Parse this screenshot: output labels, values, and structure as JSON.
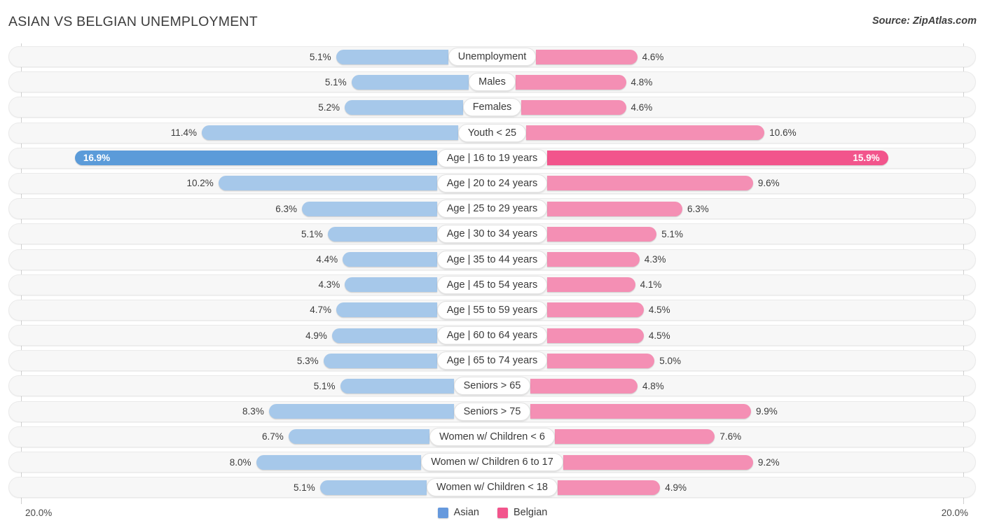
{
  "header": {
    "title": "ASIAN VS BELGIAN UNEMPLOYMENT",
    "source": "Source: ZipAtlas.com"
  },
  "footer": {
    "axis_left": "20.0%",
    "axis_right": "20.0%",
    "legend": [
      {
        "label": "Asian",
        "color": "#6699dd"
      },
      {
        "label": "Belgian",
        "color": "#f2558c"
      }
    ]
  },
  "colors": {
    "asian_light": "#a6c8ea",
    "asian_dark": "#5b9bd9",
    "belgian_light": "#f48fb4",
    "belgian_dark": "#f2558c",
    "track": "#f7f7f7",
    "axis": "#cfcfcf"
  },
  "chart_data": {
    "type": "bar",
    "subtype": "diverging-bidirectional",
    "title": "ASIAN VS BELGIAN UNEMPLOYMENT",
    "xlabel": "",
    "ylabel": "",
    "xlim": [
      0,
      20
    ],
    "axis_max_label": "20.0%",
    "grid": false,
    "legend_position": "bottom-center",
    "categories": [
      "Unemployment",
      "Males",
      "Females",
      "Youth < 25",
      "Age | 16 to 19 years",
      "Age | 20 to 24 years",
      "Age | 25 to 29 years",
      "Age | 30 to 34 years",
      "Age | 35 to 44 years",
      "Age | 45 to 54 years",
      "Age | 55 to 59 years",
      "Age | 60 to 64 years",
      "Age | 65 to 74 years",
      "Seniors > 65",
      "Seniors > 75",
      "Women w/ Children < 6",
      "Women w/ Children 6 to 17",
      "Women w/ Children < 18"
    ],
    "series": [
      {
        "name": "Asian",
        "values": [
          5.1,
          5.1,
          5.2,
          11.4,
          16.9,
          10.2,
          6.3,
          5.1,
          4.4,
          4.3,
          4.7,
          4.9,
          5.3,
          5.1,
          8.3,
          6.7,
          8.0,
          5.1
        ]
      },
      {
        "name": "Belgian",
        "values": [
          4.6,
          4.8,
          4.6,
          10.6,
          15.9,
          9.6,
          6.3,
          5.1,
          4.3,
          4.1,
          4.5,
          4.5,
          5.0,
          4.8,
          9.9,
          7.6,
          9.2,
          4.9
        ]
      }
    ]
  },
  "rows": [
    {
      "label": "Unemployment",
      "left": "5.1%",
      "right": "4.6%",
      "lv": 5.1,
      "rv": 4.6,
      "inside_left": false,
      "inside_right": false
    },
    {
      "label": "Males",
      "left": "5.1%",
      "right": "4.8%",
      "lv": 5.1,
      "rv": 4.8,
      "inside_left": false,
      "inside_right": false
    },
    {
      "label": "Females",
      "left": "5.2%",
      "right": "4.6%",
      "lv": 5.2,
      "rv": 4.6,
      "inside_left": false,
      "inside_right": false
    },
    {
      "label": "Youth < 25",
      "left": "11.4%",
      "right": "10.6%",
      "lv": 11.4,
      "rv": 10.6,
      "inside_left": false,
      "inside_right": false
    },
    {
      "label": "Age | 16 to 19 years",
      "left": "16.9%",
      "right": "15.9%",
      "lv": 16.9,
      "rv": 15.9,
      "inside_left": true,
      "inside_right": true
    },
    {
      "label": "Age | 20 to 24 years",
      "left": "10.2%",
      "right": "9.6%",
      "lv": 10.2,
      "rv": 9.6,
      "inside_left": false,
      "inside_right": false
    },
    {
      "label": "Age | 25 to 29 years",
      "left": "6.3%",
      "right": "6.3%",
      "lv": 6.3,
      "rv": 6.3,
      "inside_left": false,
      "inside_right": false
    },
    {
      "label": "Age | 30 to 34 years",
      "left": "5.1%",
      "right": "5.1%",
      "lv": 5.1,
      "rv": 5.1,
      "inside_left": false,
      "inside_right": false
    },
    {
      "label": "Age | 35 to 44 years",
      "left": "4.4%",
      "right": "4.3%",
      "lv": 4.4,
      "rv": 4.3,
      "inside_left": false,
      "inside_right": false
    },
    {
      "label": "Age | 45 to 54 years",
      "left": "4.3%",
      "right": "4.1%",
      "lv": 4.3,
      "rv": 4.1,
      "inside_left": false,
      "inside_right": false
    },
    {
      "label": "Age | 55 to 59 years",
      "left": "4.7%",
      "right": "4.5%",
      "lv": 4.7,
      "rv": 4.5,
      "inside_left": false,
      "inside_right": false
    },
    {
      "label": "Age | 60 to 64 years",
      "left": "4.9%",
      "right": "4.5%",
      "lv": 4.9,
      "rv": 4.5,
      "inside_left": false,
      "inside_right": false
    },
    {
      "label": "Age | 65 to 74 years",
      "left": "5.3%",
      "right": "5.0%",
      "lv": 5.3,
      "rv": 5.0,
      "inside_left": false,
      "inside_right": false
    },
    {
      "label": "Seniors > 65",
      "left": "5.1%",
      "right": "4.8%",
      "lv": 5.1,
      "rv": 4.8,
      "inside_left": false,
      "inside_right": false
    },
    {
      "label": "Seniors > 75",
      "left": "8.3%",
      "right": "9.9%",
      "lv": 8.3,
      "rv": 9.9,
      "inside_left": false,
      "inside_right": false
    },
    {
      "label": "Women w/ Children < 6",
      "left": "6.7%",
      "right": "7.6%",
      "lv": 6.7,
      "rv": 7.6,
      "inside_left": false,
      "inside_right": false
    },
    {
      "label": "Women w/ Children 6 to 17",
      "left": "8.0%",
      "right": "9.2%",
      "lv": 8.0,
      "rv": 9.2,
      "inside_left": false,
      "inside_right": false
    },
    {
      "label": "Women w/ Children < 18",
      "left": "5.1%",
      "right": "4.9%",
      "lv": 5.1,
      "rv": 4.9,
      "inside_left": false,
      "inside_right": false
    }
  ]
}
